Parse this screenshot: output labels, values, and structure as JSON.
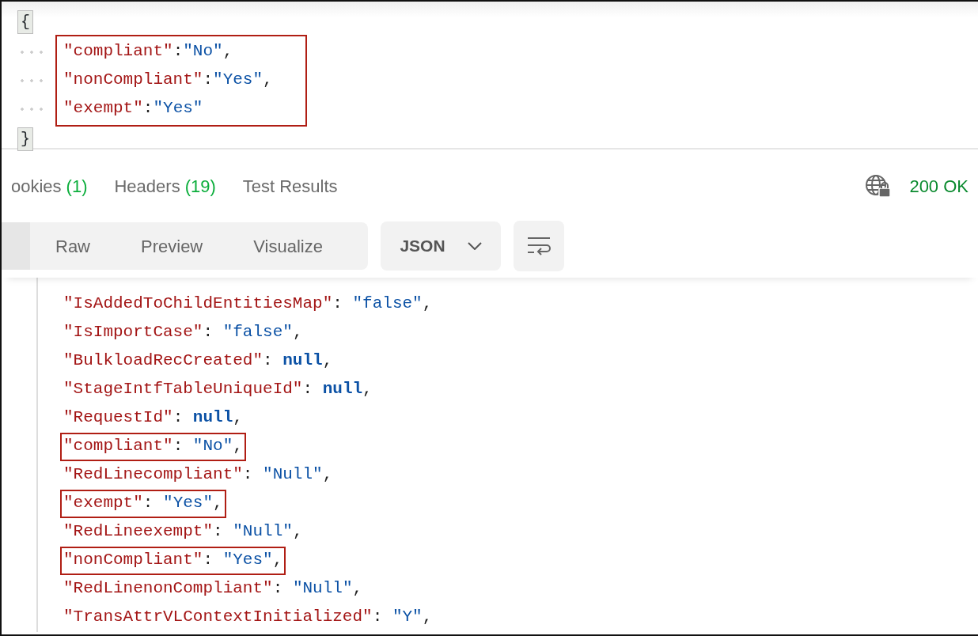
{
  "request_body": {
    "open_brace": "{",
    "close_brace": "}",
    "highlighted": true,
    "lines": [
      {
        "key": "\"compliant\"",
        "sep": ":",
        "value": "\"No\"",
        "kind": "string",
        "comma": ","
      },
      {
        "key": "\"nonCompliant\"",
        "sep": ":",
        "value": "\"Yes\"",
        "kind": "string",
        "comma": ","
      },
      {
        "key": "\"exempt\"",
        "sep": ":",
        "value": "\"Yes\"",
        "kind": "string"
      }
    ]
  },
  "response_tabs": [
    {
      "label": "ookies",
      "count": "(1)"
    },
    {
      "label": "Headers",
      "count": "(19)"
    },
    {
      "label": "Test Results"
    }
  ],
  "status": "200 OK",
  "view_tabs": [
    {
      "label": "Raw",
      "selected": false
    },
    {
      "label": "Preview",
      "selected": false
    },
    {
      "label": "Visualize",
      "selected": false
    }
  ],
  "format": "JSON",
  "response_lines": [
    {
      "key": "\"IsAddedToChildEntitiesMap\"",
      "sep": ": ",
      "value": "\"false\"",
      "kind": "string",
      "comma": ",",
      "highlighted": false
    },
    {
      "key": "\"IsImportCase\"",
      "sep": ": ",
      "value": "\"false\"",
      "kind": "string",
      "comma": ",",
      "highlighted": false
    },
    {
      "key": "\"BulkloadRecCreated\"",
      "sep": ": ",
      "value": "null",
      "kind": "null",
      "comma": ",",
      "highlighted": false
    },
    {
      "key": "\"StageIntfTableUniqueId\"",
      "sep": ": ",
      "value": "null",
      "kind": "null",
      "comma": ",",
      "highlighted": false
    },
    {
      "key": "\"RequestId\"",
      "sep": ": ",
      "value": "null",
      "kind": "null",
      "comma": ",",
      "highlighted": false
    },
    {
      "key": "\"compliant\"",
      "sep": ": ",
      "value": "\"No\"",
      "kind": "string",
      "comma": ",",
      "highlighted": true
    },
    {
      "key": "\"RedLinecompliant\"",
      "sep": ": ",
      "value": "\"Null\"",
      "kind": "string",
      "comma": ",",
      "highlighted": false
    },
    {
      "key": "\"exempt\"",
      "sep": ": ",
      "value": "\"Yes\"",
      "kind": "string",
      "comma": ",",
      "highlighted": true
    },
    {
      "key": "\"RedLineexempt\"",
      "sep": ": ",
      "value": "\"Null\"",
      "kind": "string",
      "comma": ",",
      "highlighted": false
    },
    {
      "key": "\"nonCompliant\"",
      "sep": ": ",
      "value": "\"Yes\"",
      "kind": "string",
      "comma": ",",
      "highlighted": true
    },
    {
      "key": "\"RedLinenonCompliant\"",
      "sep": ": ",
      "value": "\"Null\"",
      "kind": "string",
      "comma": ",",
      "highlighted": false
    },
    {
      "key": "\"TransAttrVLContextInitialized\"",
      "sep": ": ",
      "value": "\"Y\"",
      "kind": "string",
      "comma": ",",
      "highlighted": false
    }
  ]
}
